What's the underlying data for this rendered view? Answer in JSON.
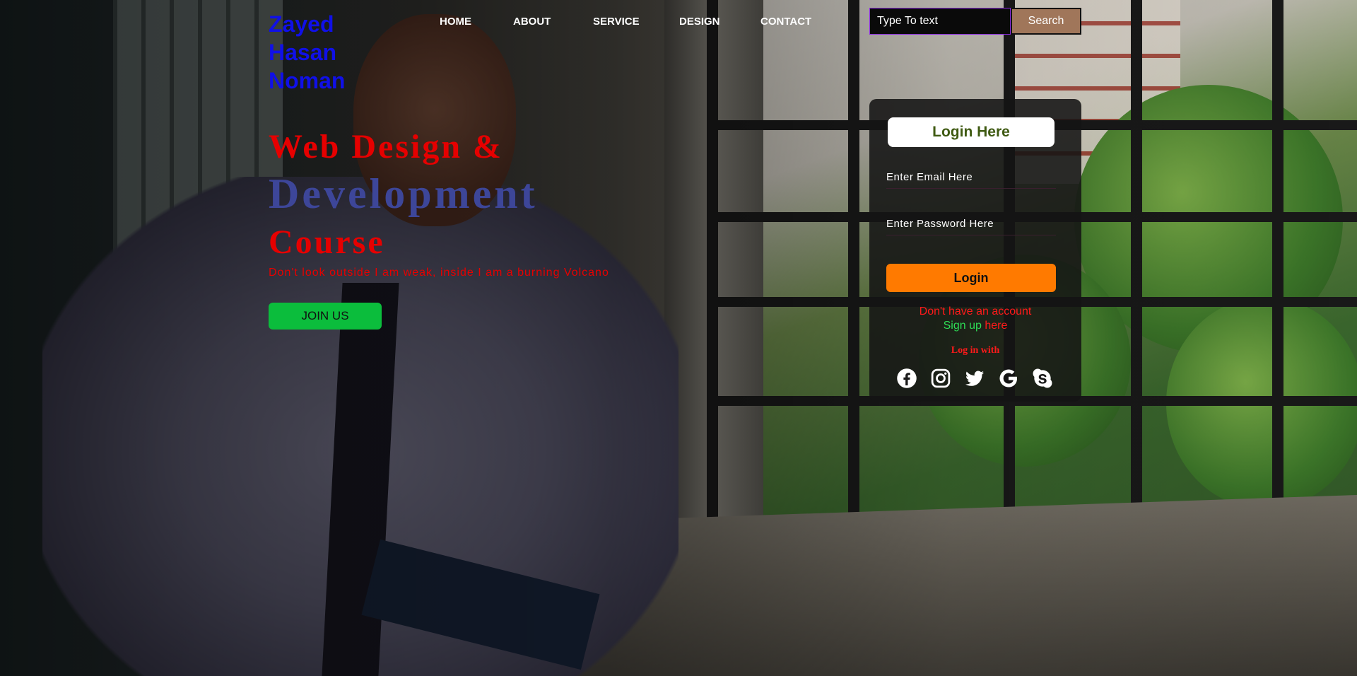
{
  "header": {
    "logo_lines": [
      "Zayed",
      "Hasan",
      "Noman"
    ],
    "nav": [
      "HOME",
      "ABOUT",
      "SERVICE",
      "DESIGN",
      "CONTACT"
    ],
    "search": {
      "placeholder": "Type To text",
      "button": "Search"
    }
  },
  "hero": {
    "line1": "Web Design &",
    "line2": "Development",
    "line3": "Course",
    "subtitle": "Don't look outside I am weak, inside I am a burning Volcano",
    "join_button": "JOIN US"
  },
  "login": {
    "title": "Login Here",
    "email_placeholder": "Enter Email Here",
    "password_placeholder": "Enter Password Here",
    "button": "Login",
    "no_account": "Don't have an account",
    "signup_text": "Sign up",
    "signup_link": "here",
    "login_with": "Log in with",
    "socials": [
      "facebook-icon",
      "instagram-icon",
      "twitter-icon",
      "google-icon",
      "skype-icon"
    ]
  },
  "colors": {
    "logo": "#1010e8",
    "hero_red": "#e60000",
    "hero_blue": "#3d4699",
    "join_green": "#0bbd3c",
    "login_orange": "#ff7a00",
    "search_brown": "#a0765a",
    "title_olive": "#3f5a12"
  }
}
